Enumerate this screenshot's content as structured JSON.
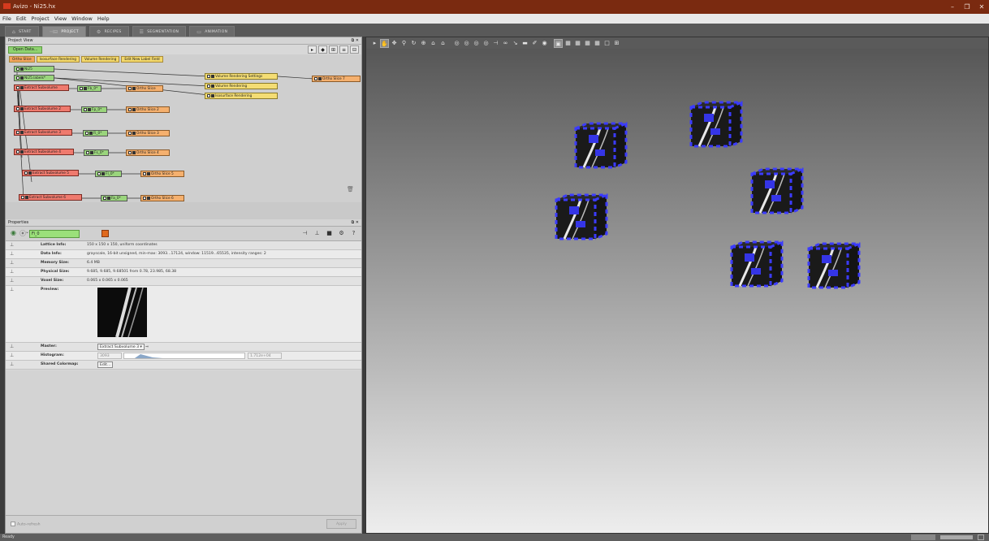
{
  "window": {
    "title": "Avizo - Ni25.hx",
    "controls": [
      "–",
      "❐",
      "✕"
    ]
  },
  "menu": [
    "File",
    "Edit",
    "Project",
    "View",
    "Window",
    "Help"
  ],
  "tabs": [
    {
      "label": "START",
      "icon": "⌂"
    },
    {
      "label": "PROJECT",
      "icon": "⊣⊟"
    },
    {
      "label": "RECIPES",
      "icon": "⚙"
    },
    {
      "label": "SEGMENTATION",
      "icon": "☰"
    },
    {
      "label": "ANIMATION",
      "icon": "▭"
    }
  ],
  "project_view": {
    "title": "Project View",
    "open_data": "Open Data...",
    "quick_modules": [
      "Ortho Slice",
      "Isosurface Rendering",
      "Volume Rendering",
      "Edit New Label Field"
    ],
    "nodes": {
      "ni25": "Ni25",
      "ni25_labels": "Ni25.labels*",
      "vrs": "Volume Rendering Settings",
      "vr": "Volume Rendering",
      "iso": "Isosurface Rendering",
      "os7": "Ortho Slice 7",
      "es1": "Extract Subvolume",
      "fb": "Fb_0*",
      "os1": "Ortho Slice",
      "es2": "Extract Subvolume 2",
      "fp": "Fp_0*",
      "os2": "Ortho Slice 2",
      "es3": "Extract Subvolume 3",
      "fi": "Fi_0*",
      "os3": "Ortho Slice 3",
      "es4": "Extract Subvolume 4",
      "fs": "Fs_0*",
      "os4": "Ortho Slice 4",
      "es5": "Extract Subvolume 5",
      "fl": "Fl_0*",
      "os5": "Ortho Slice 5",
      "es6": "Extract Subvolume 6",
      "fa": "Fa_0*",
      "os6": "Ortho Slice 6"
    }
  },
  "properties": {
    "title": "Properties",
    "selected": "Fi_0",
    "rows": [
      {
        "k": "Lattice Info:",
        "v": "150 x 150 x 150, uniform coordinates"
      },
      {
        "k": "Data Info:",
        "v": "grayscale, 16-bit unsigned, min-max: 3093...17124, window: 11519...65535, intensity ranges: 2"
      },
      {
        "k": "Memory Size:",
        "v": "6.4 MB"
      },
      {
        "k": "Physical Size:",
        "v": "9.685, 9.685, 9.68501 from 0.78, 23.985, 68.38"
      },
      {
        "k": "Voxel Size:",
        "v": "0.065 x 0.065 x 0.065"
      }
    ],
    "preview_label": "Preview:",
    "master_label": "Master:",
    "master_value": "Extract Subvolume 3",
    "histogram_label": "Histogram:",
    "hist_min": "3093",
    "hist_max": "1.712e+04",
    "colormap_label": "Shared Colormap:",
    "colormap_value": "Edit...",
    "auto_refresh": "Auto-refresh",
    "apply": "Apply"
  },
  "status": "Ready"
}
